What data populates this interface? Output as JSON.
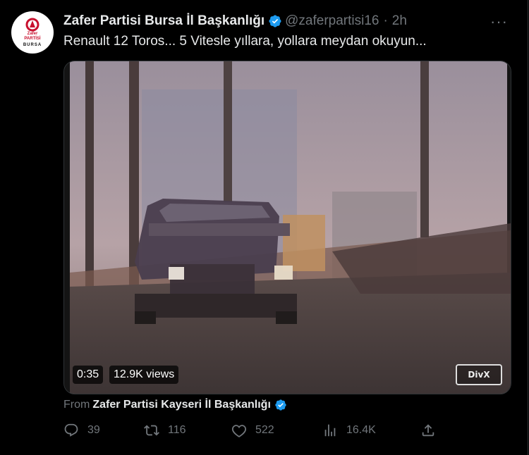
{
  "tweet": {
    "author_name": "Zafer Partisi Bursa İl Başkanlığı",
    "handle": "@zaferpartisi16",
    "separator": "·",
    "time": "2h",
    "text": "Renault 12 Toros... 5 Vitesle yıllara, yollara meydan okuyun...",
    "more_label": "···"
  },
  "avatar": {
    "logo_line1": "Zafer",
    "logo_line2": "PARTİSİ",
    "logo_line3": "BURSA"
  },
  "video": {
    "duration": "0:35",
    "views": "12.9K views",
    "watermark": "DivX"
  },
  "source": {
    "label": "From",
    "name": "Zafer Partisi Kayseri İl Başkanlığı"
  },
  "actions": {
    "replies": "39",
    "retweets": "116",
    "likes": "522",
    "views": "16.4K"
  },
  "colors": {
    "background": "#000000",
    "text": "#e7e9ea",
    "muted": "#71767b",
    "verified": "#1d9bf0",
    "brand_red": "#c8102e"
  },
  "icons": [
    "verified-badge-icon",
    "more-icon",
    "reply-icon",
    "retweet-icon",
    "like-icon",
    "views-icon",
    "share-icon",
    "play-video"
  ]
}
